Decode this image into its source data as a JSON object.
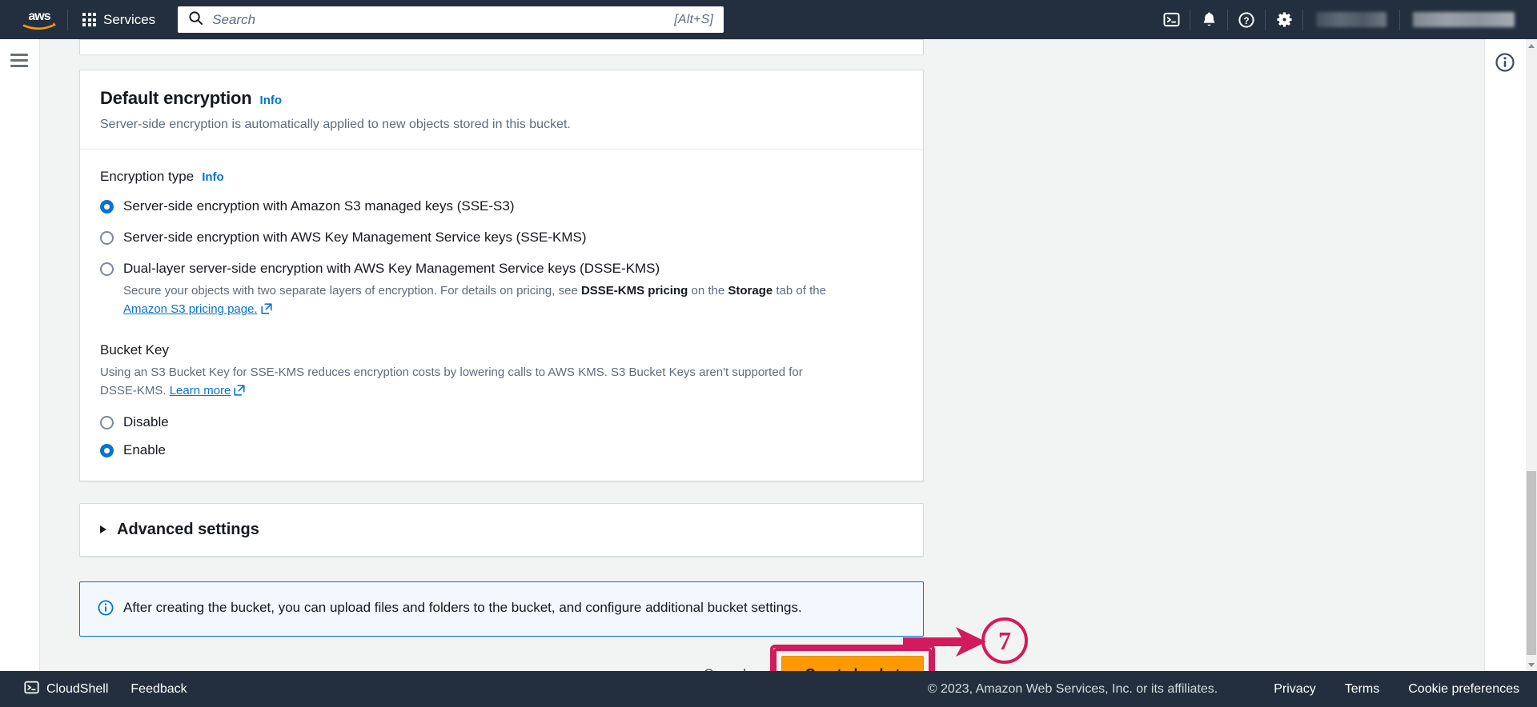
{
  "topnav": {
    "logo_alt": "aws",
    "services_label": "Services",
    "search": {
      "placeholder": "Search",
      "value": "",
      "shortcut": "[Alt+S]"
    },
    "icons": [
      {
        "name": "cloudshell-icon",
        "label": "CloudShell"
      },
      {
        "name": "notifications-bell-icon",
        "label": "Notifications"
      },
      {
        "name": "help-question-icon",
        "label": "Help"
      },
      {
        "name": "settings-gear-icon",
        "label": "Settings"
      }
    ]
  },
  "sidebar": {
    "menu_label": "Open navigation"
  },
  "encryption_card": {
    "title": "Default encryption",
    "info_label": "Info",
    "subtitle": "Server-side encryption is automatically applied to new objects stored in this bucket.",
    "encryption_type_label": "Encryption type",
    "encryption_type_info": "Info",
    "options": [
      {
        "label": "Server-side encryption with Amazon S3 managed keys (SSE-S3)",
        "selected": true,
        "description": "",
        "link_text": "",
        "desc_before_link": ""
      },
      {
        "label": "Server-side encryption with AWS Key Management Service keys (SSE-KMS)",
        "selected": false,
        "description": "",
        "link_text": "",
        "desc_before_link": ""
      },
      {
        "label": "Dual-layer server-side encryption with AWS Key Management Service keys (DSSE-KMS)",
        "selected": false,
        "desc_part1": "Secure your objects with two separate layers of encryption. For details on pricing, see ",
        "desc_bold1": "DSSE-KMS pricing",
        "desc_part2": " on the ",
        "desc_bold2": "Storage",
        "desc_part3": " tab of the ",
        "link_text": "Amazon S3 pricing page."
      }
    ],
    "bucket_key": {
      "heading": "Bucket Key",
      "desc_part1": "Using an S3 Bucket Key for SSE-KMS reduces encryption costs by lowering calls to AWS KMS. S3 Bucket Keys aren't supported for DSSE-KMS. ",
      "link_text": "Learn more",
      "options": [
        {
          "label": "Disable",
          "selected": false
        },
        {
          "label": "Enable",
          "selected": true
        }
      ]
    }
  },
  "advanced": {
    "title": "Advanced settings",
    "expanded": false
  },
  "alert": {
    "icon": "info-circle-icon",
    "text": "After creating the bucket, you can upload files and folders to the bucket, and configure additional bucket settings."
  },
  "actions": {
    "cancel_label": "Cancel",
    "create_label": "Create bucket",
    "annotation_number": "7",
    "annotation_color": "#d31a5d"
  },
  "right_panel": {
    "info_icon": "info-circle-icon"
  },
  "footer": {
    "cloudshell_label": "CloudShell",
    "feedback_label": "Feedback",
    "copyright": "© 2023, Amazon Web Services, Inc. or its affiliates.",
    "links": [
      "Privacy",
      "Terms",
      "Cookie preferences"
    ]
  },
  "colors": {
    "nav_background": "#232f3e",
    "accent_blue": "#0972d3",
    "button_orange": "#ff9900",
    "annotation_pink": "#d31a5d",
    "page_background": "#f2f3f3"
  }
}
